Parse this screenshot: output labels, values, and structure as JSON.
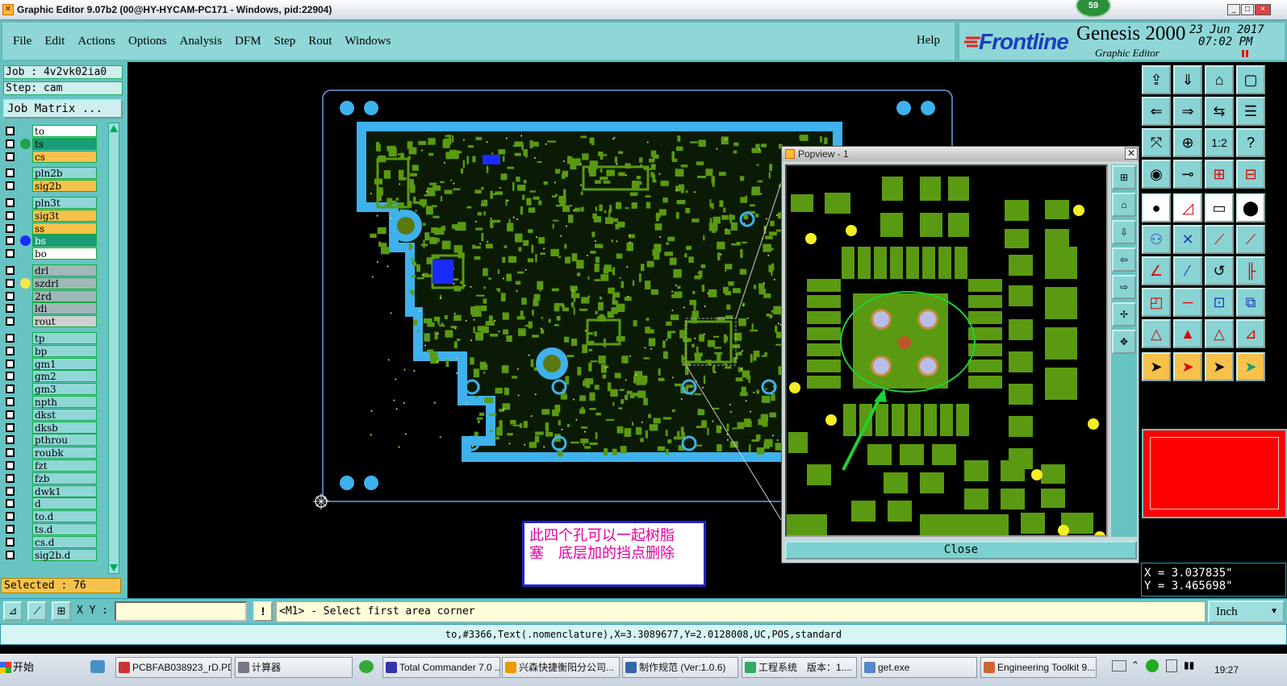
{
  "window": {
    "title": "Graphic Editor 9.07b2 (00@HY-HYCAM-PC171 - Windows, pid:22904)",
    "badge": "59",
    "controls": [
      "_",
      "□",
      "×"
    ]
  },
  "menu": {
    "items": [
      "File",
      "Edit",
      "Actions",
      "Options",
      "Analysis",
      "DFM",
      "Step",
      "Rout",
      "Windows"
    ],
    "help": "Help"
  },
  "brand": {
    "logo": "Frontline",
    "product": "Genesis 2000",
    "subtitle": "Graphic Editor",
    "date": "23 Jun 2017",
    "time": "07:02 PM"
  },
  "left_panel": {
    "job": "Job : 4v2vk02ia0",
    "step": "Step: cam",
    "job_matrix": "Job Matrix ...",
    "layers": [
      {
        "name": "to",
        "bg": "#ffffff",
        "dot": "",
        "dark": false
      },
      {
        "name": "ts",
        "bg": "#1a9c78",
        "dot": "#1fa34a",
        "dark": false
      },
      {
        "name": "cs",
        "bg": "#f7c24b",
        "dot": "",
        "dark": false
      },
      {
        "name": "pln2b",
        "bg": "#8fd7d7",
        "dot": "",
        "dark": false
      },
      {
        "name": "sig2b",
        "bg": "#f7c24b",
        "dot": "",
        "dark": false
      },
      {
        "name": "pln3t",
        "bg": "#8fd7d7",
        "dot": "",
        "dark": false
      },
      {
        "name": "sig3t",
        "bg": "#f7c24b",
        "dot": "",
        "dark": false
      },
      {
        "name": "ss",
        "bg": "#f7c24b",
        "dot": "",
        "dark": false
      },
      {
        "name": "bs",
        "bg": "#1a9c78",
        "dot": "#1a2bff",
        "dark": true
      },
      {
        "name": "bo",
        "bg": "#ffffff",
        "dot": "",
        "dark": false
      },
      {
        "name": "drl",
        "bg": "#9fb8b8",
        "dot": "",
        "dark": false
      },
      {
        "name": "szdrl",
        "bg": "#9fb8b8",
        "dot": "#f4e84a",
        "dark": false
      },
      {
        "name": "2rd",
        "bg": "#9fb8b8",
        "dot": "",
        "dark": false
      },
      {
        "name": "ldi",
        "bg": "#9fb8b8",
        "dot": "",
        "dark": false
      },
      {
        "name": "rout",
        "bg": "#d0d0d0",
        "dot": "",
        "dark": false
      },
      {
        "name": "tp",
        "bg": "#8fd7d7",
        "dot": "",
        "dark": false
      },
      {
        "name": "bp",
        "bg": "#8fd7d7",
        "dot": "",
        "dark": false
      },
      {
        "name": "gm1",
        "bg": "#8fd7d7",
        "dot": "",
        "dark": false
      },
      {
        "name": "gm2",
        "bg": "#8fd7d7",
        "dot": "",
        "dark": false
      },
      {
        "name": "gm3",
        "bg": "#8fd7d7",
        "dot": "",
        "dark": false
      },
      {
        "name": "npth",
        "bg": "#8fd7d7",
        "dot": "",
        "dark": false
      },
      {
        "name": "dkst",
        "bg": "#8fd7d7",
        "dot": "",
        "dark": false
      },
      {
        "name": "dksb",
        "bg": "#8fd7d7",
        "dot": "",
        "dark": false
      },
      {
        "name": "pthrou",
        "bg": "#8fd7d7",
        "dot": "",
        "dark": false
      },
      {
        "name": "roubk",
        "bg": "#8fd7d7",
        "dot": "",
        "dark": false
      },
      {
        "name": "fzt",
        "bg": "#8fd7d7",
        "dot": "",
        "dark": false
      },
      {
        "name": "fzb",
        "bg": "#8fd7d7",
        "dot": "",
        "dark": false
      },
      {
        "name": "dwk1",
        "bg": "#8fd7d7",
        "dot": "",
        "dark": false
      },
      {
        "name": "d",
        "bg": "#8fd7d7",
        "dot": "",
        "dark": false
      },
      {
        "name": "to.d",
        "bg": "#8fd7d7",
        "dot": "",
        "dark": false
      },
      {
        "name": "ts.d",
        "bg": "#8fd7d7",
        "dot": "",
        "dark": false
      },
      {
        "name": "cs.d",
        "bg": "#8fd7d7",
        "dot": "",
        "dark": false
      },
      {
        "name": "sig2b.d",
        "bg": "#8fd7d7",
        "dot": "",
        "dark": false
      }
    ],
    "selected": "Selected : 76"
  },
  "popview": {
    "title": "Popview - 1",
    "close": "Close"
  },
  "annotation": {
    "line1": "此四个孔可以一起树脂",
    "line2": "塞　底层加的挡点删除"
  },
  "coords": {
    "x": "X = 3.037835\"",
    "y": "Y = 3.465698\""
  },
  "command": {
    "xy_label": "X Y :",
    "input_value": "",
    "prompt": "<M1> - Select first area corner",
    "units": "Inch"
  },
  "status": "to,#3366,Text(.nomenclature),X=3.3089677,Y=2.0128008,UC,POS,standard",
  "taskbar": {
    "start": "开始",
    "tasks": [
      "PCBFAB038923_rD.PD...",
      "计算器",
      "Total Commander 7.0 ...",
      "兴森快捷衡阳分公司...",
      "制作规范 (Ver:1.0.6)",
      "工程系统　版本：1....",
      "get.exe",
      "Engineering Toolkit 9...."
    ],
    "clock": "19:27"
  },
  "colors": {
    "panel": "#68c3c3",
    "pad": "#5a9a12",
    "copper_outline": "#3fb1ec",
    "profile": "#6b9fd8",
    "highlight_circle": "#1fd134",
    "arrow": "#1fd134",
    "drill": "#f5ee24",
    "selected_bg": "#f7c24b",
    "swatch": "#ff0000"
  }
}
